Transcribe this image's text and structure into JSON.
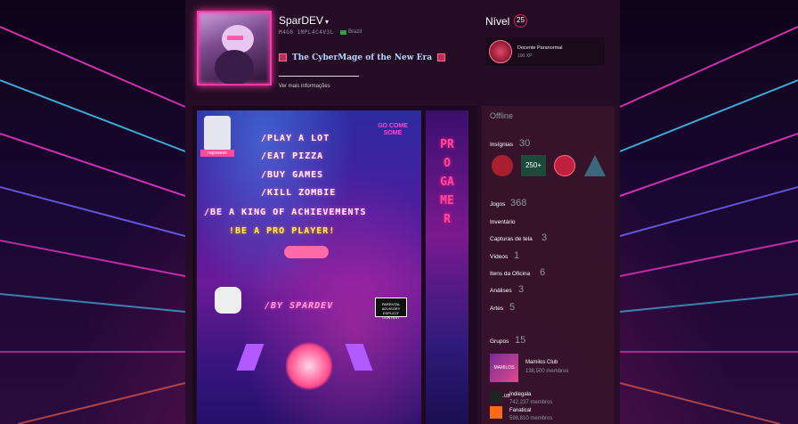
{
  "profile": {
    "persona_name": "SparDEV",
    "real_name": "M4G0 1MPL4C4V3L",
    "country": "Brazil",
    "summary": "The CyberMage of the New Era",
    "view_more": "Ver mais informações"
  },
  "level": {
    "label": "Nível",
    "value": "25",
    "featured_badge": {
      "name": "Docente Paranormal",
      "xp": "100 XP"
    }
  },
  "showcase": {
    "lines": [
      "/PLAY A LOT",
      "/EAT PIZZA",
      "/BUY GAMES",
      "/KILL ZOMBIE",
      "/BE A KING OF ACHIEVEMENTS",
      "!BE A PRO PLAYER!",
      "/BY SPARDEV"
    ],
    "side_text": "PRO GAMER",
    "sticker_left": "rapoweek",
    "sticker_right": "GO COME SOME",
    "advisory": "PARENTAL ADVISORY EXPLICIT CONTENT"
  },
  "sidebar": {
    "status": "Offline",
    "badges": {
      "label": "Insígnias",
      "count": "30",
      "thumb_text": "250+"
    },
    "games": {
      "label": "Jogos",
      "count": "368"
    },
    "inventory": {
      "label": "Inventário"
    },
    "screenshots": {
      "label": "Capturas de tela",
      "count": "3"
    },
    "videos": {
      "label": "Vídeos",
      "count": "1"
    },
    "workshop": {
      "label": "Itens da Oficina",
      "count": "6"
    },
    "reviews": {
      "label": "Análises",
      "count": "3"
    },
    "artwork": {
      "label": "Artes",
      "count": "5"
    },
    "groups": {
      "label": "Grupos",
      "count": "15",
      "items": [
        {
          "name": "Mamilos Club",
          "members": "138,500 membros",
          "icon_text": "MAMILOS CLUB"
        },
        {
          "name": "Indiegala",
          "members": "742,237 membros"
        },
        {
          "name": "Fanatical",
          "members": "598,810 membros"
        }
      ]
    }
  },
  "colors": {
    "accent": "#ff3aa8",
    "level_ring": "#e0234e",
    "muted": "#8f98a0"
  }
}
